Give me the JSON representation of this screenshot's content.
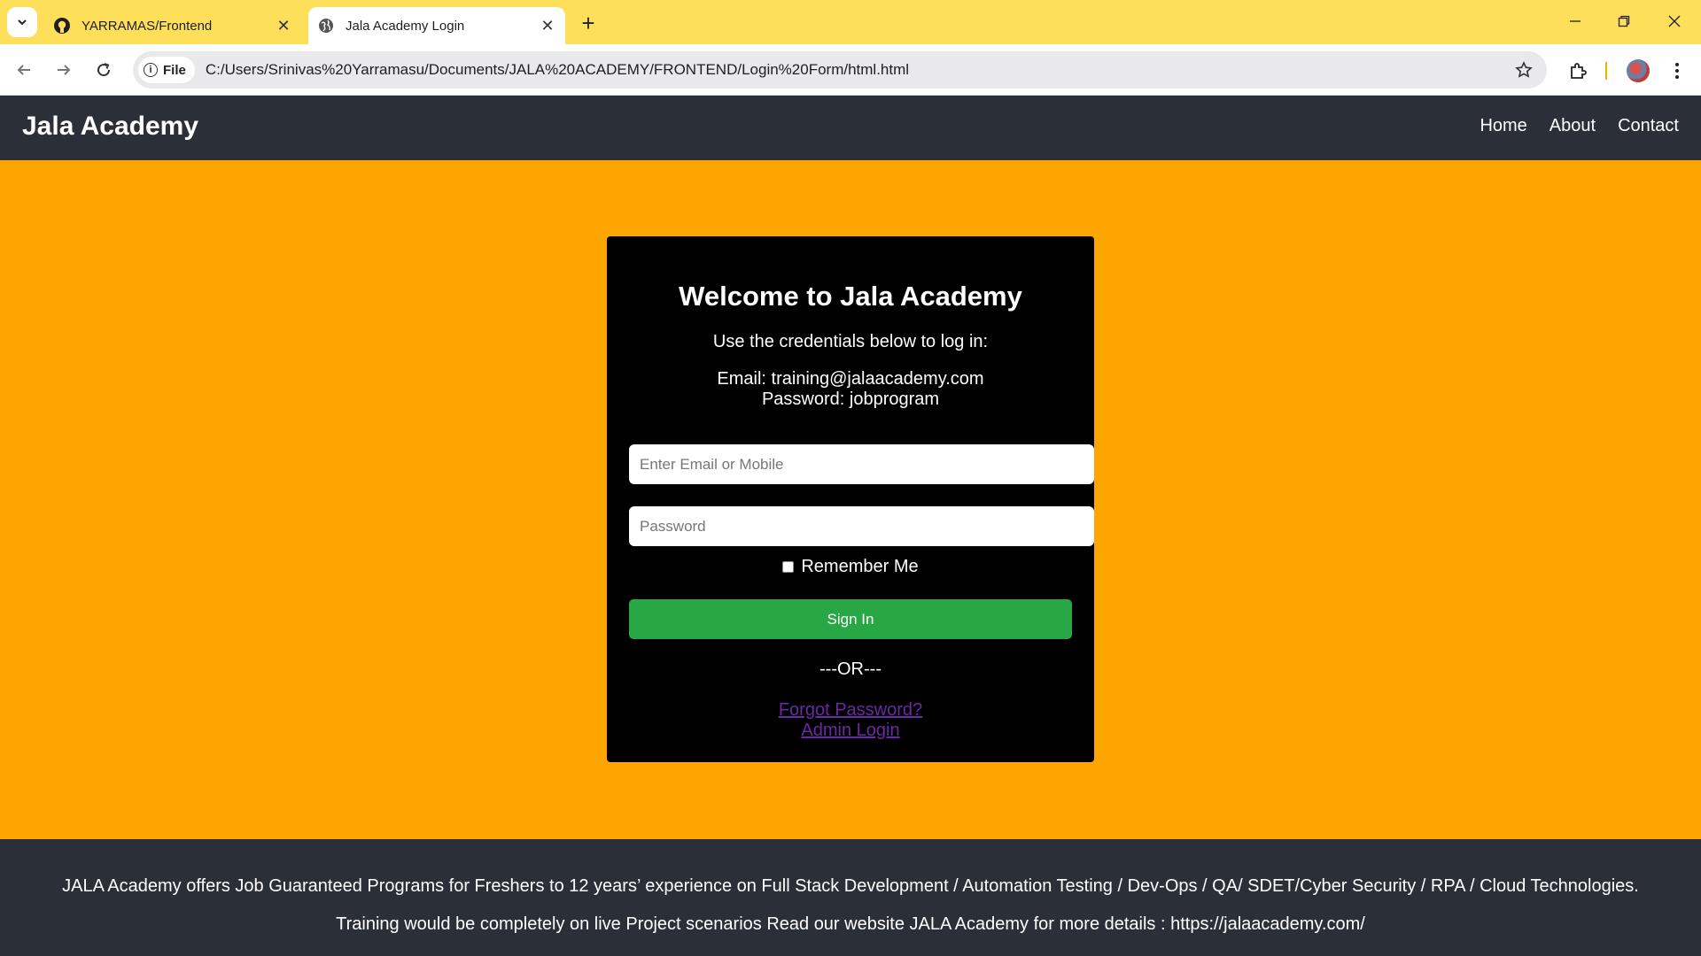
{
  "browser": {
    "tabs": [
      {
        "title": "YARRAMAS/Frontend",
        "icon": "github-icon",
        "active": false
      },
      {
        "title": "Jala Academy Login",
        "icon": "globe-icon",
        "active": true
      }
    ],
    "address": {
      "scheme_label": "File",
      "url": "C:/Users/Srinivas%20Yarramasu/Documents/JALA%20ACADEMY/FRONTEND/Login%20Form/html.html"
    }
  },
  "site": {
    "brand": "Jala Academy",
    "nav": [
      "Home",
      "About",
      "Contact"
    ]
  },
  "login": {
    "title": "Welcome to Jala Academy",
    "instructions": "Use the credentials below to log in:",
    "email_line": "Email: training@jalaacademy.com",
    "password_line": "Password: jobprogram",
    "email_placeholder": "Enter Email or Mobile",
    "password_placeholder": "Password",
    "remember_label": "Remember Me",
    "remember_checked": false,
    "signin_label": "Sign In",
    "or_text": "---OR---",
    "forgot_link": "Forgot Password?",
    "admin_link": "Admin Login"
  },
  "footer": {
    "line1": "JALA Academy offers Job Guaranteed Programs for Freshers to 12 years’ experience on Full Stack Development / Automation Testing / Dev-Ops / QA/ SDET/Cyber Security / RPA / Cloud Technologies.",
    "line2": "Training would be completely on live Project scenarios Read our website JALA Academy for more details : https://jalaacademy.com/"
  },
  "colors": {
    "page_background": "#ffa500",
    "header_footer": "#2b2f38",
    "card": "#000000",
    "signin_button": "#28a745",
    "link": "#6a2aa0",
    "tabbar": "#fddf5a"
  }
}
